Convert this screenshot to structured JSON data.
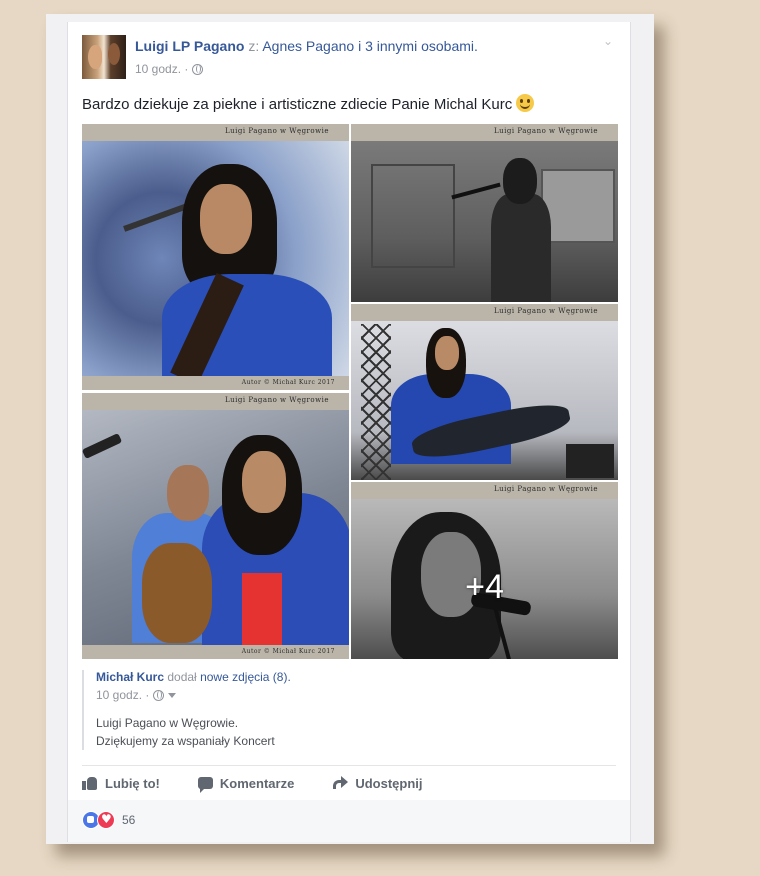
{
  "post": {
    "author": "Luigi LP Pagano",
    "with_prefix": "z:",
    "with_people": "Agnes Pagano i 3 innymi osobami.",
    "time": "10 godz. ·",
    "text": "Bardzo dziekuje za piekne i artisticzne zdiecie Panie Michal Kurc"
  },
  "photos": {
    "banner_text": "Luigi Pagano w Węgrowie",
    "footer_text": "Autor © Michał Kurc 2017",
    "more_count": "+4"
  },
  "shared": {
    "author": "Michał Kurc",
    "action": "dodał",
    "link": "nowe zdjęcia (8).",
    "time": "10 godz. ·",
    "line1": "Luigi Pagano w Węgrowie.",
    "line2": "Dziękujemy za wspaniały Koncert"
  },
  "actions": {
    "like": "Lubię to!",
    "comment": "Komentarze",
    "share": "Udostępnij"
  },
  "reactions": {
    "count": "56",
    "types": [
      "like",
      "love"
    ]
  },
  "colors": {
    "link_blue": "#365899",
    "background": "#e6d8c4"
  }
}
